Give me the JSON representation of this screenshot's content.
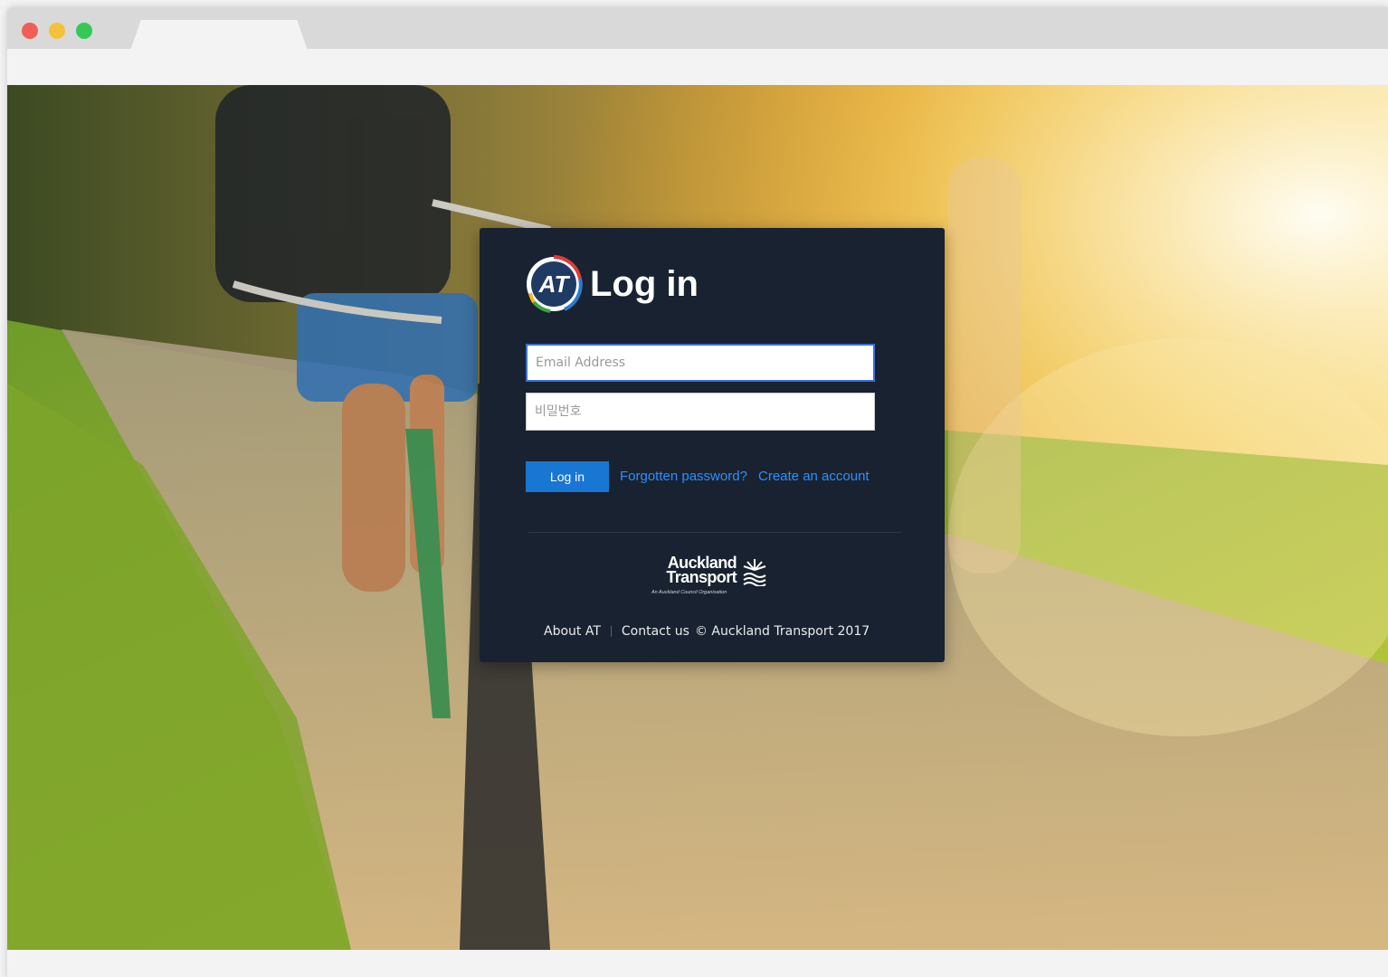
{
  "page": {
    "title": "Log in",
    "brand_colors": {
      "card": "#192230",
      "accent": "#1976d2",
      "link": "#2e8fff"
    }
  },
  "form": {
    "email_placeholder": "Email Address",
    "password_placeholder": "비밀번호",
    "login_button": "Log in",
    "forgot_link": "Forgotten password?",
    "create_link": "Create an account"
  },
  "brand": {
    "line1": "Auckland",
    "line2": "Transport",
    "tagline": "An Auckland Council Organisation",
    "logo_letters": "AT"
  },
  "footer": {
    "about": "About AT",
    "contact": "Contact us",
    "copyright": "© Auckland Transport 2017"
  }
}
